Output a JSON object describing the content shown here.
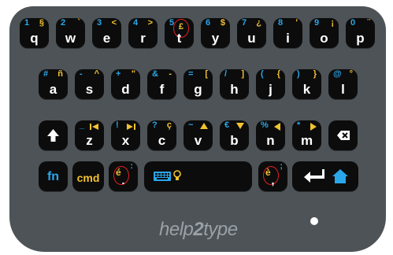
{
  "rows": [
    [
      {
        "main": "q",
        "tl": "1",
        "tr": "§"
      },
      {
        "main": "w",
        "tl": "2",
        "tr": "`"
      },
      {
        "main": "e",
        "tl": "3",
        "tr": "<"
      },
      {
        "main": "r",
        "tl": "4",
        "tr": ">"
      },
      {
        "main": "t",
        "tl": "5",
        "tr": "£"
      },
      {
        "main": "y",
        "tl": "6",
        "tr": "$"
      },
      {
        "main": "u",
        "tl": "7",
        "tr": "¿"
      },
      {
        "main": "i",
        "tl": "8",
        "tr": "'"
      },
      {
        "main": "o",
        "tl": "9",
        "tr": "¡"
      },
      {
        "main": "p",
        "tl": "0",
        "tr": "¨"
      }
    ],
    [
      {
        "main": "a",
        "tl": "#",
        "tr": "ñ"
      },
      {
        "main": "s",
        "tl": "-",
        "tr": "^"
      },
      {
        "main": "d",
        "tl": "+",
        "tr": "\""
      },
      {
        "main": "f",
        "tl": "&",
        "tr": "-"
      },
      {
        "main": "g",
        "tl": "=",
        "tr": "["
      },
      {
        "main": "h",
        "tl": "/",
        "tr": "]"
      },
      {
        "main": "j",
        "tl": "(",
        "tr": "{"
      },
      {
        "main": "k",
        "tl": ")",
        "tr": "}"
      },
      {
        "main": "l",
        "tl": "@",
        "tr": "°"
      }
    ],
    [
      {
        "main": "z",
        "tl": "_",
        "tr": ""
      },
      {
        "main": "x",
        "tl": "!",
        "tr": ""
      },
      {
        "main": "c",
        "tl": "?",
        "tr": "ç"
      },
      {
        "main": "v",
        "tl": "~",
        "tr": ""
      },
      {
        "main": "b",
        "tl": "€",
        "tr": ""
      },
      {
        "main": "n",
        "tl": "%",
        "tr": ""
      },
      {
        "main": "m",
        "tl": "*",
        "tr": ""
      }
    ]
  ],
  "bottom": {
    "fn_label": "fn",
    "cmd_label": "cmd",
    "left_accent": "é",
    "left_sub": ".",
    "left_colon": ":",
    "right_accent": "è",
    "right_sub": ",",
    "right_semicolon": ";"
  },
  "brand": {
    "part1": "help",
    "part2": "2",
    "part3": "type"
  },
  "colors": {
    "board": "#4d5357",
    "key": "#0c0c0c",
    "primary": "#2aa7ea",
    "secondary": "#f2c230",
    "highlight": "#e02020"
  },
  "icons": [
    "shift-arrow-icon",
    "backspace-icon",
    "keyboard-icon",
    "lightbulb-icon",
    "enter-arrow-icon",
    "home-icon"
  ]
}
